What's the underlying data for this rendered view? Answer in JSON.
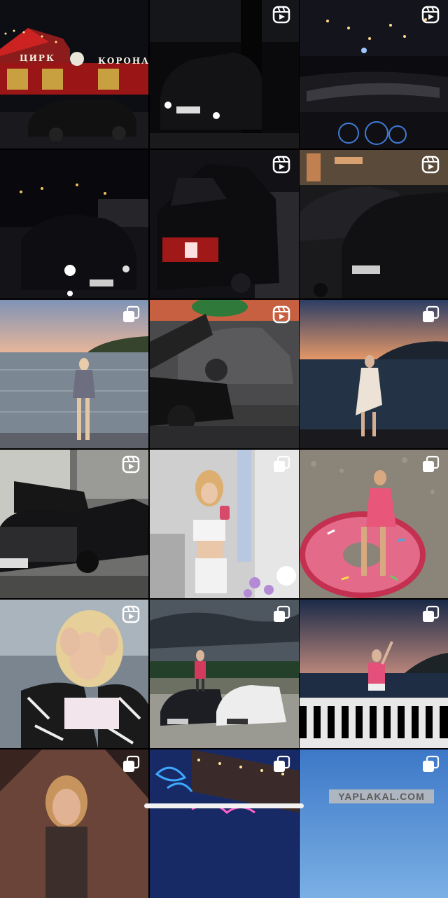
{
  "feed": {
    "tiles": [
      {
        "scene": "night-car-circus",
        "badge": "none",
        "sign_left": "ЦИРК",
        "sign_right": "КОРОНА"
      },
      {
        "scene": "night-car-parking",
        "badge": "reel"
      },
      {
        "scene": "night-road-dashboard",
        "badge": "reel"
      },
      {
        "scene": "night-car-street",
        "badge": "none"
      },
      {
        "scene": "night-car-taillight",
        "badge": "reel"
      },
      {
        "scene": "night-two-cars",
        "badge": "reel"
      },
      {
        "scene": "sunset-sea-girl",
        "badge": "carousel"
      },
      {
        "scene": "car-open-hood",
        "badge": "reel"
      },
      {
        "scene": "dusk-sea-girl-dress",
        "badge": "carousel"
      },
      {
        "scene": "car-garage-hood",
        "badge": "reel"
      },
      {
        "scene": "girl-mirror-selfie",
        "badge": "carousel"
      },
      {
        "scene": "girl-donut-towel",
        "badge": "carousel"
      },
      {
        "scene": "girl-zebra-jacket",
        "badge": "reel"
      },
      {
        "scene": "girl-two-cars-field",
        "badge": "carousel"
      },
      {
        "scene": "girl-balustrade-sea",
        "badge": "carousel"
      },
      {
        "scene": "girl-portrait",
        "badge": "carousel"
      },
      {
        "scene": "neon-sign",
        "badge": "carousel"
      },
      {
        "scene": "blue-sky",
        "badge": "carousel"
      }
    ]
  },
  "watermark": {
    "text": "YAPLAKAL.COM"
  },
  "colors": {
    "background": "#000000",
    "badge": "#ffffff",
    "home_indicator": "#f2f2f2"
  }
}
